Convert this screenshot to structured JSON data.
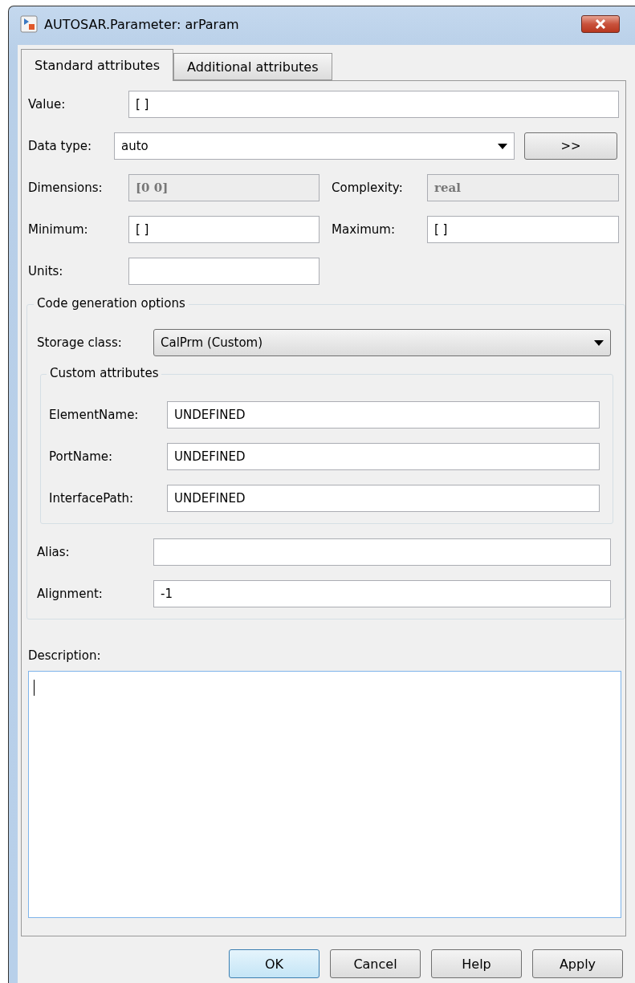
{
  "window": {
    "title": "AUTOSAR.Parameter: arParam"
  },
  "tabs": [
    {
      "label": "Standard attributes",
      "selected": true
    },
    {
      "label": "Additional attributes",
      "selected": false
    }
  ],
  "rows": [
    {
      "fields": [
        {
          "label": "Value:",
          "value": "[ ]",
          "kind": "text"
        }
      ]
    },
    {
      "fields": [
        {
          "label": "Data type:",
          "value": "auto",
          "kind": "select"
        },
        {
          "label": ">>",
          "kind": "button"
        }
      ]
    },
    {
      "fields": [
        {
          "label": "Dimensions:",
          "value": "[0 0]",
          "kind": "readonly"
        },
        {
          "label": "Complexity:",
          "value": "real",
          "kind": "readonly"
        }
      ]
    },
    {
      "fields": [
        {
          "label": "Minimum:",
          "value": "[ ]",
          "kind": "text"
        },
        {
          "label": "Maximum:",
          "value": "[ ]",
          "kind": "text"
        }
      ]
    },
    {
      "fields": [
        {
          "label": "Units:",
          "kind": "text-half"
        }
      ]
    }
  ],
  "code_generation": {
    "title": "Code generation options",
    "storage_class": {
      "label": "Storage class:",
      "value": "CalPrm (Custom)"
    },
    "custom_attributes": {
      "title": "Custom attributes",
      "fields": [
        {
          "label": "ElementName:",
          "value": "UNDEFINED"
        },
        {
          "label": "PortName:",
          "value": "UNDEFINED"
        },
        {
          "label": "InterfacePath:",
          "value": "UNDEFINED"
        }
      ]
    },
    "fields": [
      {
        "label": "Alias:"
      },
      {
        "label": "Alignment:",
        "value": "-1"
      }
    ]
  },
  "description": {
    "label": "Description:"
  },
  "buttons": [
    {
      "label": "OK",
      "default": true
    },
    {
      "label": "Cancel",
      "default": false
    },
    {
      "label": "Help",
      "default": false
    },
    {
      "label": "Apply",
      "default": false
    }
  ]
}
